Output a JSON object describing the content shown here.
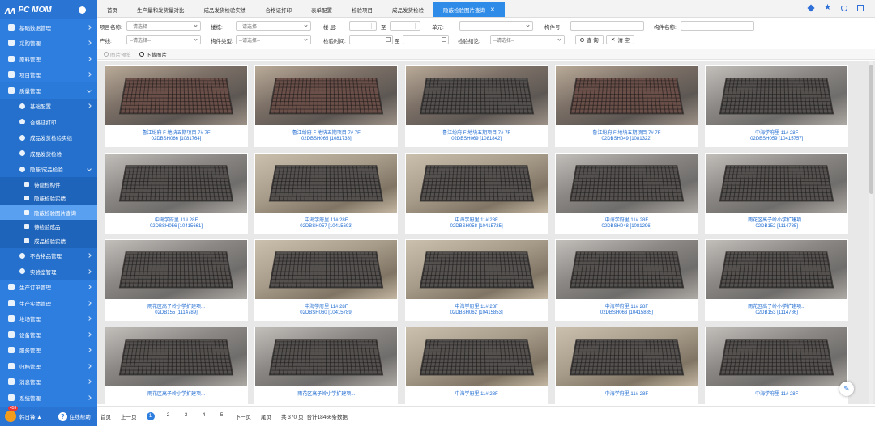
{
  "app": {
    "logo_mark": "ᴧᴧ",
    "name": "PC MOM"
  },
  "sidebar": {
    "items": [
      {
        "label": "基础数据管理",
        "level": 1,
        "chevron": "right"
      },
      {
        "label": "采购管理",
        "level": 1,
        "chevron": "right"
      },
      {
        "label": "原料管理",
        "level": 1,
        "chevron": "right"
      },
      {
        "label": "项目管理",
        "level": 1,
        "chevron": "right"
      },
      {
        "label": "质量管理",
        "level": 1,
        "chevron": "down",
        "state": "expanded"
      },
      {
        "label": "基础配置",
        "level": 2,
        "chevron": "right"
      },
      {
        "label": "合格证打印",
        "level": 2
      },
      {
        "label": "成品发货检验实绩",
        "level": 2
      },
      {
        "label": "成品发货检验",
        "level": 2
      },
      {
        "label": "隐蔽/成品检验",
        "level": 2,
        "chevron": "down",
        "state": "expanded"
      },
      {
        "label": "待隐检构件",
        "level": 3
      },
      {
        "label": "隐蔽检验实绩",
        "level": 3
      },
      {
        "label": "隐蔽检验图片查询",
        "level": 3,
        "state": "active"
      },
      {
        "label": "待检验成品",
        "level": 3
      },
      {
        "label": "成品检验实绩",
        "level": 3
      },
      {
        "label": "不合格品管理",
        "level": 2,
        "chevron": "right"
      },
      {
        "label": "实验室管理",
        "level": 2,
        "chevron": "right"
      },
      {
        "label": "生产订单管理",
        "level": 1,
        "chevron": "right"
      },
      {
        "label": "生产实绩管理",
        "level": 1,
        "chevron": "right"
      },
      {
        "label": "堆场管理",
        "level": 1,
        "chevron": "right"
      },
      {
        "label": "设备管理",
        "level": 1,
        "chevron": "right"
      },
      {
        "label": "服务管理",
        "level": 1,
        "chevron": "right"
      },
      {
        "label": "归档管理",
        "level": 1,
        "chevron": "right"
      },
      {
        "label": "消息管理",
        "level": 1,
        "chevron": "right"
      },
      {
        "label": "系统管理",
        "level": 1,
        "chevron": "right"
      }
    ],
    "bottom": {
      "badge": "459",
      "user": "韩日锋 ▲",
      "help": "在线帮助"
    }
  },
  "tabs": [
    {
      "label": "首页",
      "active": false
    },
    {
      "label": "生产量和发货量对比",
      "active": false
    },
    {
      "label": "成品发货检验实绩",
      "active": false
    },
    {
      "label": "合格证打印",
      "active": false
    },
    {
      "label": "表单配置",
      "active": false
    },
    {
      "label": "检验项目",
      "active": false
    },
    {
      "label": "成品发货检验",
      "active": false
    },
    {
      "label": "隐蔽检验图片查询",
      "active": true,
      "close": "✕"
    }
  ],
  "filters": {
    "project_name_label": "项目名称:",
    "project_name_placeholder": "--请选择--",
    "building_label": "楼栋:",
    "building_placeholder": "--请选择--",
    "floor_label": "楼  层:",
    "floor_to": "至",
    "unit_label": "单元:",
    "component_no_label": "构件号:",
    "component_name_label": "构件名称:",
    "product_line_label": "产线:",
    "product_line_placeholder": "--请选择--",
    "component_type_label": "构件类型:",
    "component_type_placeholder": "--请选择--",
    "inspect_time_label": "检验时间:",
    "inspect_time_to": "至",
    "inspect_result_label": "检验结论:",
    "inspect_result_placeholder": "--请选择--",
    "query_button": "查 询",
    "clear_button": "清 空"
  },
  "toolbar": {
    "preview_label": "图片预览",
    "download_label": "下载图片"
  },
  "cards": [
    {
      "line1": "鲁江纷府 F 地块五期项目 7# 7F",
      "line2": "02DBSH066 [1081764]"
    },
    {
      "line1": "鲁江纷府 F 地块五期项目 7# 7F",
      "line2": "02DBSH065 [1081738]"
    },
    {
      "line1": "鲁江纷府 F 地块五期项目 7# 7F",
      "line2": "02DBSH069 [1081842]"
    },
    {
      "line1": "鲁江纷府 F 地块五期项目 7# 7F",
      "line2": "02DBSH049 [1081322]"
    },
    {
      "line1": "中海学府里 11# 28F",
      "line2": "02DBSH059 [10415757]"
    },
    {
      "line1": "中海学府里 11# 28F",
      "line2": "02DBSH056 [10415661]"
    },
    {
      "line1": "中海学府里 11# 28F",
      "line2": "02DBSH057 [10415693]"
    },
    {
      "line1": "中海学府里 11# 28F",
      "line2": "02DBSH058 [10415725]"
    },
    {
      "line1": "中海学府里 11# 28F",
      "line2": "02DBSH048 [1081296]"
    },
    {
      "line1": "雨花区高子岭小学扩建项...",
      "line2": "02DB152 [1114785]"
    },
    {
      "line1": "雨花区高子岭小学扩建项...",
      "line2": "02DB155 [1114789]"
    },
    {
      "line1": "中海学府里 11# 28F",
      "line2": "02DBSH060 [10415789]"
    },
    {
      "line1": "中海学府里 11# 28F",
      "line2": "02DBSH062 [10415853]"
    },
    {
      "line1": "中海学府里 11# 28F",
      "line2": "02DBSH063 [10415885]"
    },
    {
      "line1": "雨花区高子岭小学扩建项...",
      "line2": "02DB153 [1114786]"
    },
    {
      "line1": "雨花区高子岭小学扩建项...",
      "line2": ""
    },
    {
      "line1": "雨花区高子岭小学扩建项...",
      "line2": ""
    },
    {
      "line1": "中海学府里 11# 28F",
      "line2": ""
    },
    {
      "line1": "中海学府里 11# 28F",
      "line2": ""
    },
    {
      "line1": "中海学府里 11# 28F",
      "line2": ""
    }
  ],
  "pager": {
    "first": "首页",
    "prev": "上一页",
    "pages": [
      "1",
      "2",
      "3",
      "4",
      "5"
    ],
    "current": "1",
    "next": "下一页",
    "last": "尾页",
    "total_pages": "共 370 页",
    "total_records": "合计18466条数据"
  },
  "colors": {
    "sidebar": "#2e7ee0",
    "accent": "#2e8be8",
    "caption": "#1e6ad0"
  }
}
